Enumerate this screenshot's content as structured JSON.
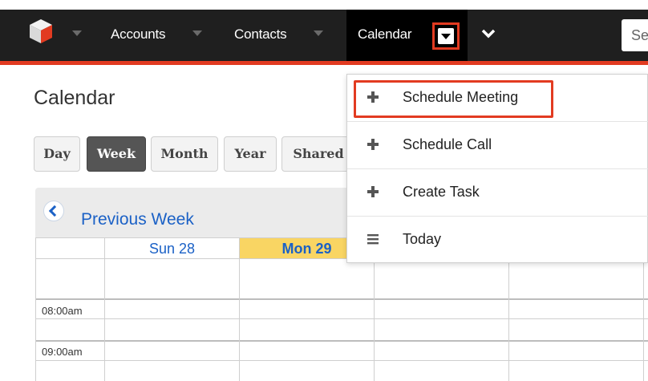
{
  "navbar": {
    "items": [
      {
        "label": "Accounts"
      },
      {
        "label": "Contacts"
      },
      {
        "label": "Calendar"
      }
    ],
    "search_text": "Se"
  },
  "page": {
    "title": "Calendar",
    "views": [
      "Day",
      "Week",
      "Month",
      "Year",
      "Shared"
    ],
    "active_view": "Week"
  },
  "calendar": {
    "prev_label": "Previous Week",
    "days": [
      {
        "label": "Sun 28",
        "today": false
      },
      {
        "label": "Mon 29",
        "today": true
      }
    ],
    "times": [
      "08:00am",
      "09:00am"
    ]
  },
  "dropdown": {
    "items": [
      {
        "label": "Schedule Meeting",
        "icon": "plus-icon"
      },
      {
        "label": "Schedule Call",
        "icon": "plus-icon"
      },
      {
        "label": "Create Task",
        "icon": "plus-icon"
      },
      {
        "label": "Today",
        "icon": "list-icon"
      }
    ]
  },
  "colors": {
    "nav_bg": "#1f1f1f",
    "accent": "#e23b21",
    "link_blue": "#1b61c6",
    "today_yellow": "#f9d563"
  }
}
